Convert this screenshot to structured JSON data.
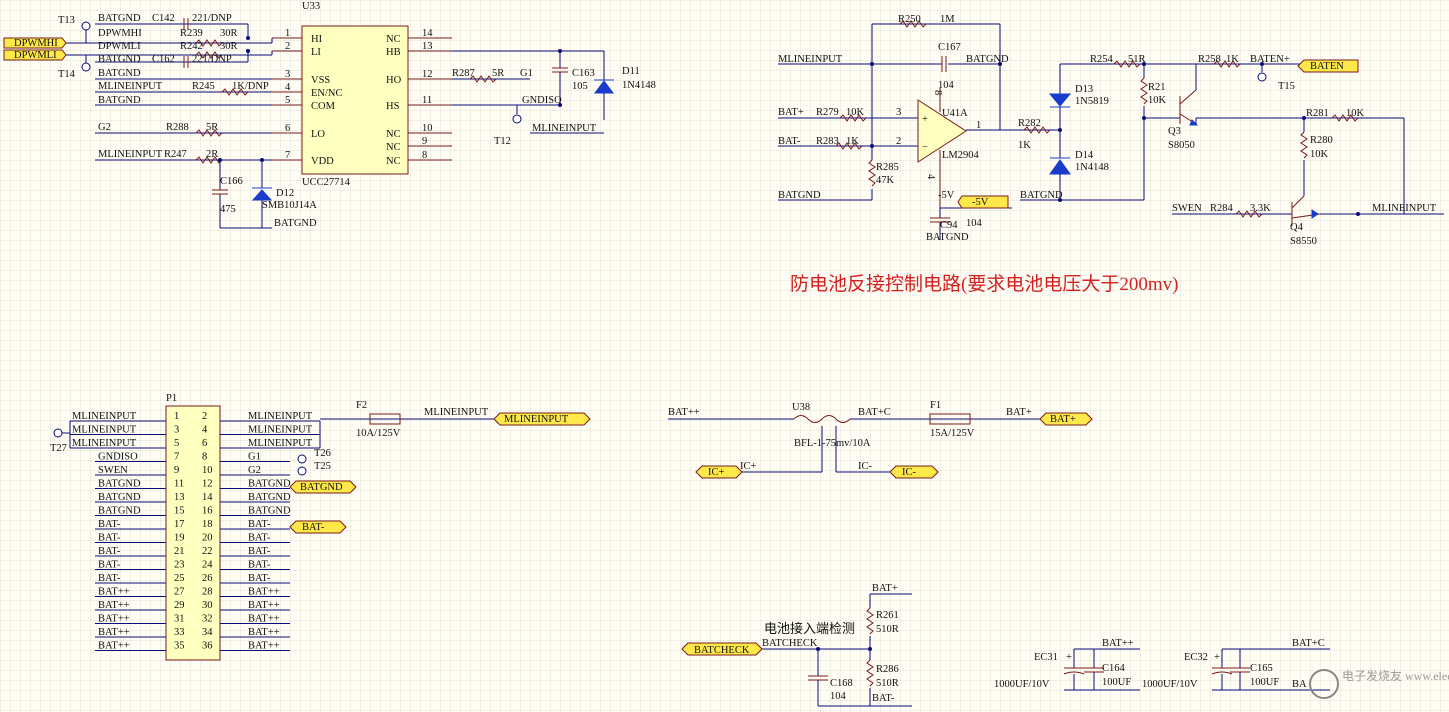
{
  "title": "防电池反接控制电路(要求电池电压大于200mv)",
  "watermark": "电子发烧友 www.elecfans.com",
  "u33": {
    "ref": "U33",
    "part": "UCC27714",
    "pins_left": [
      {
        "name": "HI",
        "num": "1"
      },
      {
        "name": "LI",
        "num": "2"
      },
      {
        "name": "VSS",
        "num": "3"
      },
      {
        "name": "EN/NC",
        "num": "4"
      },
      {
        "name": "COM",
        "num": "5"
      },
      {
        "name": "LO",
        "num": "6"
      },
      {
        "name": "VDD",
        "num": "7"
      }
    ],
    "pins_right": [
      {
        "name": "NC",
        "num": "14"
      },
      {
        "name": "HB",
        "num": "13"
      },
      {
        "name": "HO",
        "num": "12"
      },
      {
        "name": "HS",
        "num": "11"
      },
      {
        "name": "NC",
        "num": "10"
      },
      {
        "name": "NC",
        "num": "9"
      },
      {
        "name": "NC",
        "num": "8"
      }
    ],
    "nets": [
      "BATGND",
      "DPWMHI",
      "DPWMLI",
      "BATGND",
      "MLINEINPUT",
      "BATGND",
      "G2",
      "MLINEINPUT"
    ],
    "ports": [
      "DPWMHI",
      "DPWMLI"
    ],
    "testpoints": [
      "T13",
      "T14",
      "T12"
    ],
    "parts": {
      "c142": "C142",
      "c142v": "221/DNP",
      "r239": "R239",
      "r239v": "30R",
      "r242": "R242",
      "r242v": "30R",
      "c162": "C162",
      "c162v": "221/DNP",
      "r245": "R245",
      "r245v": "1K/DNP",
      "r288": "R288",
      "r288v": "5R",
      "r247": "R247",
      "r247v": "2R",
      "c166": "C166",
      "c166v": "475",
      "d12": "D12",
      "d12v": "SMB10J14A",
      "batgnd": "BATGND",
      "r287": "R287",
      "r287v": "5R",
      "g1": "G1",
      "c163": "C163",
      "c163v": "105",
      "d11": "D11",
      "d11v": "1N4148",
      "gndiso": "GNDISO",
      "mline": "MLINEINPUT"
    }
  },
  "opamp": {
    "r250": "R250",
    "r250v": "1M",
    "c167": "C167",
    "c167v": "104",
    "mline": "MLINEINPUT",
    "batgnd": "BATGND",
    "batp": "BAT+",
    "r279": "R279",
    "r279v": "10K",
    "u41": "U41A",
    "batm": "BAT-",
    "r283": "R283",
    "r283v": "1K",
    "r285": "R285",
    "r285v": "47K",
    "part": "LM2904",
    "neg5": "-5V",
    "port_neg5": "-5V",
    "c94": "C94",
    "c94v": "104",
    "batgnd2": "BATGND",
    "batgnd3": "BATGND",
    "r282": "R282",
    "r282v": "1K",
    "pin3": "3",
    "pin2": "2",
    "pin1": "1",
    "pin8": "8",
    "pin4": "4",
    "d13": "D13",
    "d13v": "1N5819",
    "d14": "D14",
    "d14v": "1N4148",
    "r254": "R254",
    "r254v": "51R",
    "r21": "R21",
    "r21v": "10K",
    "r258": "R258",
    "r258v": "1K",
    "baten": "BATEN+",
    "port_baten": "BATEN",
    "t15": "T15",
    "q3": "Q3",
    "q3v": "S8050",
    "r281": "R281",
    "r281v": "10K",
    "r280": "R280",
    "r280v": "10K",
    "swen": "SWEN",
    "r284": "R284",
    "r284v": "3.3K",
    "q4": "Q4",
    "q4v": "S8550",
    "mline2": "MLINEINPUT"
  },
  "p1": {
    "ref": "P1",
    "left_nums": [
      "1",
      "3",
      "5",
      "7",
      "9",
      "11",
      "13",
      "15",
      "17",
      "19",
      "21",
      "23",
      "25",
      "27",
      "29",
      "31",
      "33",
      "35"
    ],
    "right_nums": [
      "2",
      "4",
      "6",
      "8",
      "10",
      "12",
      "14",
      "16",
      "18",
      "20",
      "22",
      "24",
      "26",
      "28",
      "30",
      "32",
      "34",
      "36"
    ],
    "left_nets": [
      "MLINEINPUT",
      "MLINEINPUT",
      "MLINEINPUT",
      "GNDISO",
      "SWEN",
      "BATGND",
      "BATGND",
      "BATGND",
      "BAT-",
      "BAT-",
      "BAT-",
      "BAT-",
      "BAT-",
      "BAT++",
      "BAT++",
      "BAT++",
      "BAT++",
      "BAT++"
    ],
    "right_nets": [
      "MLINEINPUT",
      "MLINEINPUT",
      "MLINEINPUT",
      "G1",
      "G2",
      "BATGND",
      "BATGND",
      "BATGND",
      "BAT-",
      "BAT-",
      "BAT-",
      "BAT-",
      "BAT-",
      "BAT++",
      "BAT++",
      "BAT++",
      "BAT++",
      "BAT++"
    ],
    "t27": "T27",
    "t26": "T26",
    "t25": "T25",
    "f2": "F2",
    "f2v": "10A/125V",
    "mline": "MLINEINPUT",
    "port_mline": "MLINEINPUT",
    "port_batgnd": "BATGND",
    "port_batm": "BAT-"
  },
  "shunt": {
    "batpp": "BAT++",
    "u38": "U38",
    "batc": "BAT+C",
    "f1": "F1",
    "f1v": "15A/125V",
    "batp": "BAT+",
    "port_batp": "BAT+",
    "part": "BFL-1-75mv/10A",
    "icp": "IC+",
    "port_icp": "IC+",
    "icm": "IC-",
    "port_icm": "IC-"
  },
  "batcheck": {
    "batp": "BAT+",
    "r261": "R261",
    "r261v": "510R",
    "label": "电池接入端检测",
    "net": "BATCHECK",
    "port": "BATCHECK",
    "r286": "R286",
    "r286v": "510R",
    "c168": "C168",
    "c168v": "104",
    "batm": "BAT-"
  },
  "caps": {
    "ec31": "EC31",
    "ec31v": "1000UF/10V",
    "c164": "C164",
    "c164v": "100UF",
    "batpp": "BAT++",
    "ec32": "EC32",
    "ec32v": "1000UF/10V",
    "c165": "C165",
    "c165v": "100UF",
    "batc": "BAT+C",
    "ba": "BA"
  }
}
